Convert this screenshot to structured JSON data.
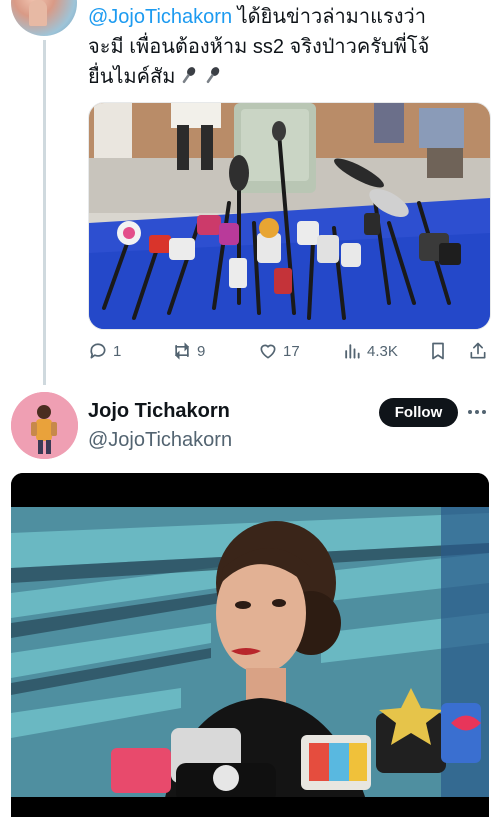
{
  "reply_tweet": {
    "mention": "@JojoTichakorn",
    "text_after_mention": " ได้ยินข่าวล่ามาแรงว่า",
    "line2": "จะมี เพื่อนต้องห้าม ss2 จริงป่าวครับพี่โจ้",
    "line3": "ยื่นไมค์สัม",
    "emoji": [
      "microphone",
      "microphone"
    ],
    "media_icons": [
      "microphones-press-conference-photo"
    ],
    "stats": {
      "replies": "1",
      "reposts": "9",
      "likes": "17",
      "views": "4.3K"
    },
    "action_icons": [
      "reply-icon",
      "repost-icon",
      "like-icon",
      "views-icon",
      "bookmark-icon",
      "share-icon"
    ]
  },
  "author_tweet": {
    "name": "Jojo Tichakorn",
    "handle": "@JojoTichakorn",
    "follow_label": "Follow",
    "more_icon": "more-icon",
    "media": "video-frame-actress-interview"
  },
  "colors": {
    "link": "#1d9bf0",
    "text": "#0f1419",
    "muted": "#536471",
    "thread_line": "#cfd9de",
    "follow_bg": "#0f1419"
  }
}
